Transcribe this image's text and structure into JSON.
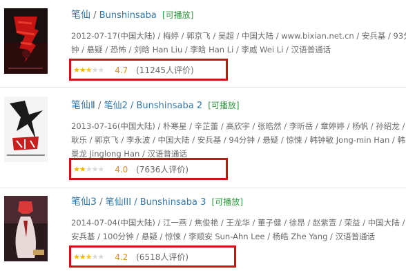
{
  "items": [
    {
      "title": "笔仙",
      "sep": "/",
      "alt_titles": "Bunshinsaba",
      "playable": "[可播放]",
      "meta_lines": [
        "2012-07-17(中国大陆) / 梅婷 / 郭京飞 / 吴超 / 中国大陆 / www.bixian.net.cn / 安兵基 / 93分",
        "钟 / 悬疑 / 恐怖 / 刘晗 Han Liu / 李晗 Han Li / 李威 Wei Li / 汉语普通话"
      ],
      "rating": 4.7,
      "stars_full": 2,
      "stars_half": 1,
      "score": "4.7",
      "count": "(11245人评价)"
    },
    {
      "title": "笔仙Ⅱ",
      "sep": "/",
      "alt_titles": "笔仙2 / Bunshinsaba 2",
      "playable": "[可播放]",
      "meta_lines": [
        "2013-07-16(中国大陆) / 朴寒星 / 辛芷蕾 / 高欣宇 / 张皓然 / 李昕岳 / 章婷婷 / 杨帆 / 孙绍龙 /",
        "耿乐 / 郭京飞 / 李永波 / 中国大陆 / 安兵基 / 94分钟 / 悬疑 / 惊悚 / 韩钟敏 Jong-min Han / 韩",
        "景龙 Jinglong Han / 汉语普通话"
      ],
      "rating": 4.0,
      "stars_full": 2,
      "stars_half": 0,
      "score": "4.0",
      "count": "(7636人评价)"
    },
    {
      "title": "笔仙3",
      "sep": "/",
      "alt_titles": "笔仙III / Bunshinsaba 3",
      "playable": "[可播放]",
      "meta_lines": [
        "2014-07-04(中国大陆) / 江一燕 / 焦俊艳 / 王龙华 / 董子健 / 徐昂 / 赵紫萱 / 荣益 / 中国大陆 /",
        "安兵基 / 100分钟 / 悬疑 / 惊悚 / 李顺安 Sun-Ahn Lee / 杨皓 Zhe Yang / 汉语普通话"
      ],
      "rating": 4.2,
      "stars_full": 2,
      "stars_half": 1,
      "score": "4.2",
      "count": "(6518人评价)"
    }
  ],
  "colors": {
    "link": "#3377aa",
    "playable": "#2e963d",
    "score": "#e09015",
    "star": "#f4b400",
    "highlight_box": "#d01010"
  },
  "icons": {
    "star": "star-icon"
  }
}
